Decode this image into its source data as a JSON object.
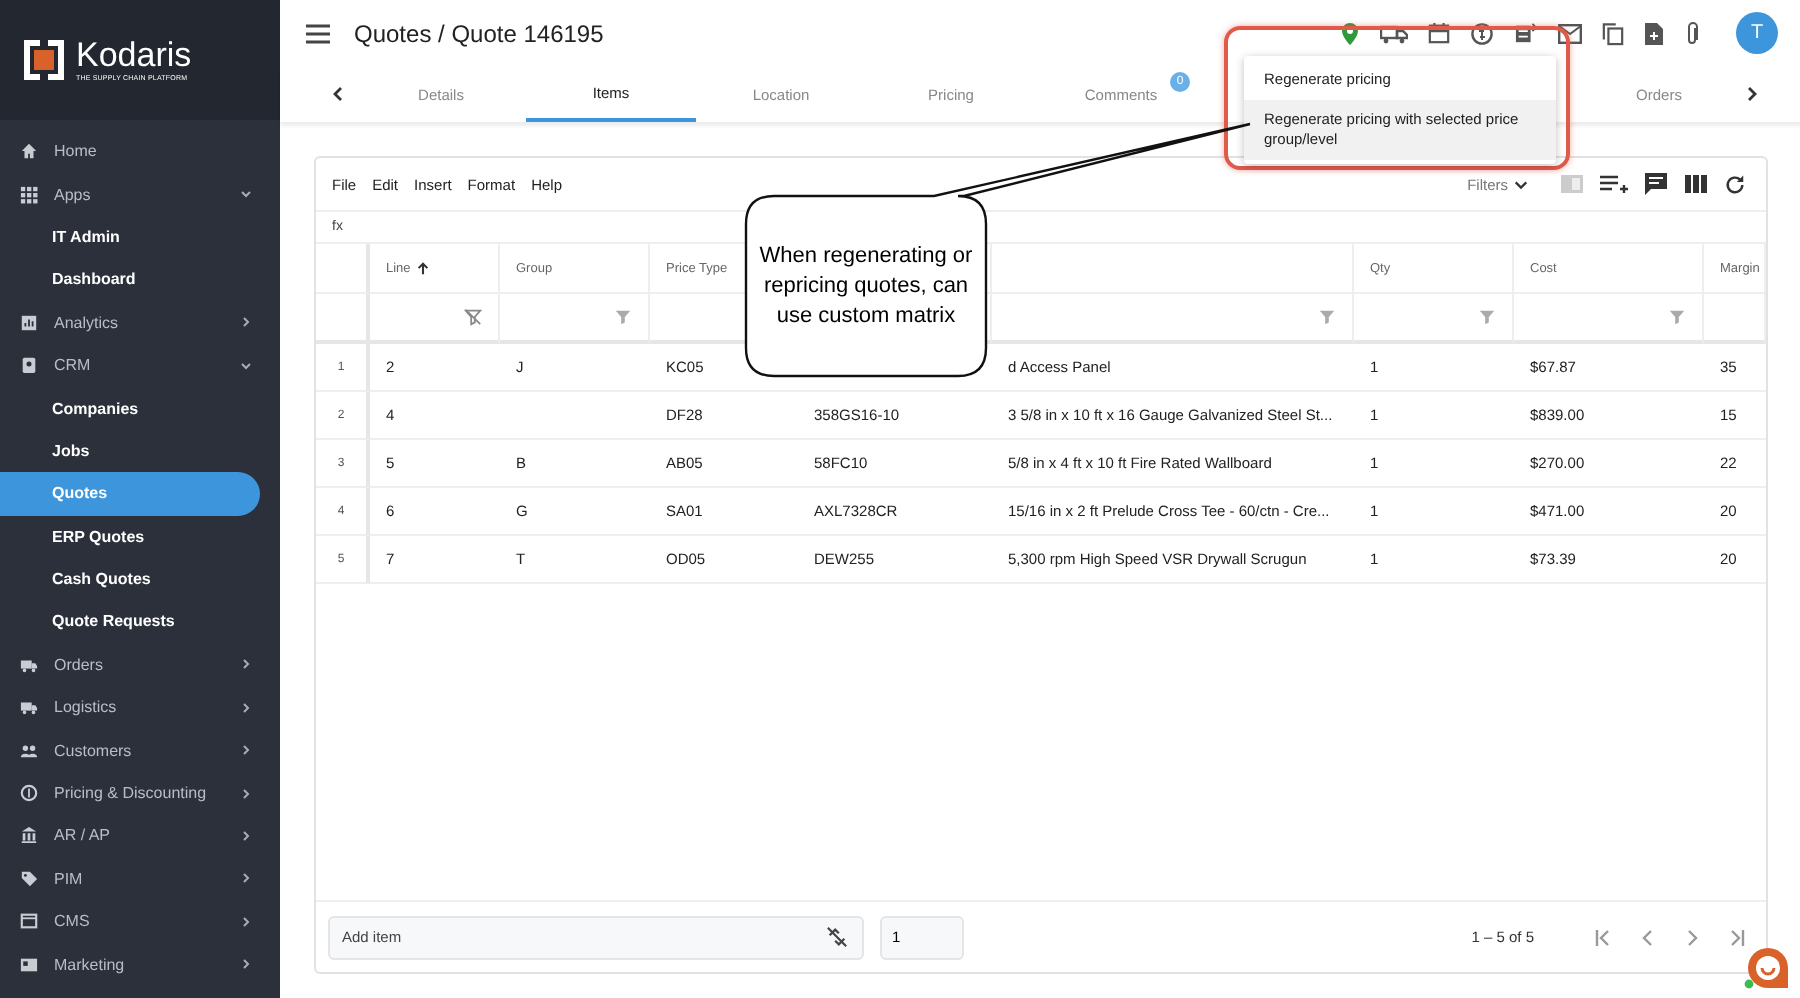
{
  "sidebar": {
    "logo": {
      "name": "Kodaris",
      "tagline": "THE SUPPLY CHAIN PLATFORM"
    },
    "items": [
      {
        "label": "Home",
        "selected": false
      },
      {
        "label": "Apps",
        "expanded": true,
        "selected": false,
        "children": [
          {
            "label": "IT Admin",
            "selected": false
          },
          {
            "label": "Dashboard",
            "selected": false
          }
        ]
      },
      {
        "label": "Analytics",
        "expanded": false,
        "selected": false
      },
      {
        "label": "CRM",
        "expanded": true,
        "selected": false,
        "children": [
          {
            "label": "Companies",
            "selected": false
          },
          {
            "label": "Jobs",
            "selected": false
          },
          {
            "label": "Quotes",
            "selected": true
          },
          {
            "label": "ERP Quotes",
            "selected": false
          },
          {
            "label": "Cash Quotes",
            "selected": false
          },
          {
            "label": "Quote Requests",
            "selected": false
          }
        ]
      },
      {
        "label": "Orders",
        "expanded": false,
        "selected": false
      },
      {
        "label": "Logistics",
        "expanded": false,
        "selected": false
      },
      {
        "label": "Customers",
        "expanded": false,
        "selected": false
      },
      {
        "label": "Pricing & Discounting",
        "expanded": false,
        "selected": false
      },
      {
        "label": "AR / AP",
        "expanded": false,
        "selected": false
      },
      {
        "label": "PIM",
        "expanded": false,
        "selected": false
      },
      {
        "label": "CMS",
        "expanded": false,
        "selected": false
      },
      {
        "label": "Marketing",
        "expanded": false,
        "selected": false
      }
    ]
  },
  "header": {
    "title": "Quotes / Quote 146195",
    "avatar": "T"
  },
  "tabs": [
    {
      "label": "Details",
      "selected": false
    },
    {
      "label": "Items",
      "selected": true
    },
    {
      "label": "Location",
      "selected": false
    },
    {
      "label": "Pricing",
      "selected": false
    },
    {
      "label": "Comments",
      "selected": false,
      "badge": "0"
    },
    {
      "label": "Orders",
      "selected": false
    }
  ],
  "menu": {
    "items": [
      {
        "label": "Regenerate pricing",
        "selected": false
      },
      {
        "label": "Regenerate pricing with selected price group/level",
        "selected": true
      }
    ]
  },
  "callout": "When regenerating or repricing quotes, can use custom matrix",
  "toolbar": {
    "menus": [
      "File",
      "Edit",
      "Insert",
      "Format",
      "Help"
    ],
    "filters": "Filters",
    "formula_label": "fx"
  },
  "table": {
    "columns": [
      {
        "label": "Line",
        "sorted": true
      },
      {
        "label": "Group",
        "sorted": false
      },
      {
        "label": "Price Type",
        "sorted": false
      },
      {},
      {},
      {
        "label": "Qty",
        "sorted": false
      },
      {
        "label": "Cost",
        "sorted": false
      },
      {
        "label": "Margin"
      }
    ],
    "rows": [
      {
        "num": "1",
        "cells": [
          "2",
          "J",
          "KC05",
          "",
          "d Access Panel",
          "1",
          "$67.87",
          "35"
        ]
      },
      {
        "num": "2",
        "cells": [
          "4",
          "",
          "DF28",
          "358GS16-10",
          "3 5/8 in x 10 ft x 16 Gauge Galvanized Steel St...",
          "1",
          "$839.00",
          "15"
        ]
      },
      {
        "num": "3",
        "cells": [
          "5",
          "B",
          "AB05",
          "58FC10",
          "5/8 in x 4 ft x 10 ft Fire Rated Wallboard",
          "1",
          "$270.00",
          "22"
        ]
      },
      {
        "num": "4",
        "cells": [
          "6",
          "G",
          "SA01",
          "AXL7328CR",
          "15/16 in x 2 ft Prelude Cross Tee - 60/ctn - Cre...",
          "1",
          "$471.00",
          "20"
        ]
      },
      {
        "num": "5",
        "cells": [
          "7",
          "T",
          "OD05",
          "DEW255",
          "5,300 rpm High Speed VSR Drywall Scrugun",
          "1",
          "$73.39",
          "20"
        ]
      }
    ]
  },
  "footer": {
    "add_item": {
      "placeholder": "Add item"
    },
    "quantity": {
      "value": "1"
    },
    "pagination": "1 – 5 of 5"
  }
}
